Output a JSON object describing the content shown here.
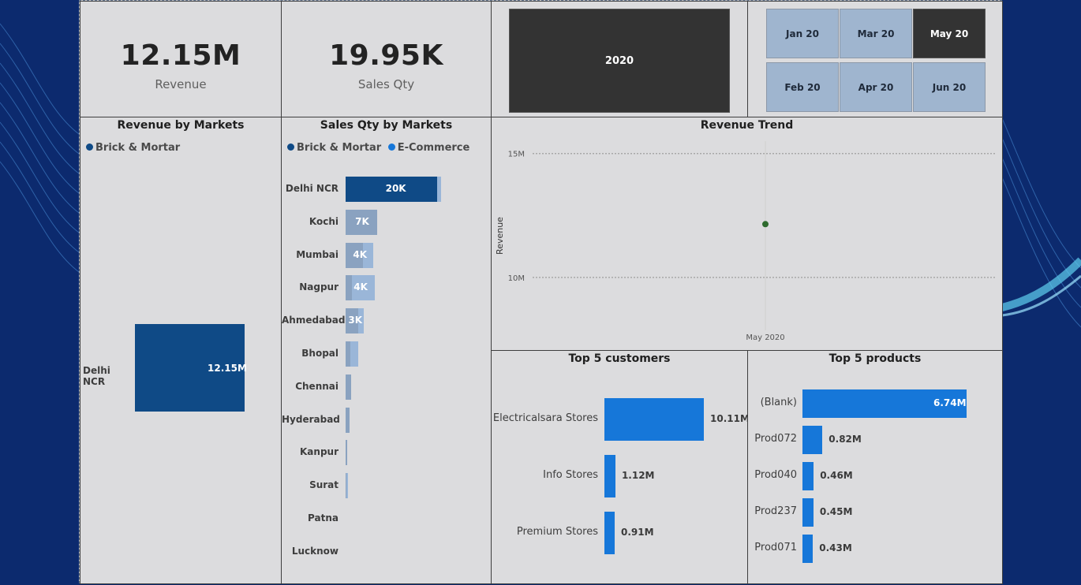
{
  "kpis": [
    {
      "value": "12.15M",
      "label": "Revenue"
    },
    {
      "value": "19.95K",
      "label": "Sales Qty"
    }
  ],
  "year_slicer": {
    "selected": "2020"
  },
  "month_slicer": {
    "items": [
      "Jan 20",
      "Mar 20",
      "May 20",
      "Feb 20",
      "Apr 20",
      "Jun 20"
    ],
    "selected": "May 20"
  },
  "revenue_by_markets": {
    "title": "Revenue by Markets",
    "legend": [
      {
        "name": "Brick & Mortar",
        "color": "#0f4a86"
      }
    ],
    "category": "Delhi NCR",
    "value_label": "12.15M"
  },
  "sales_qty_by_markets": {
    "title": "Sales Qty by Markets",
    "legend": [
      {
        "name": "Brick & Mortar",
        "color": "#0f4a86"
      },
      {
        "name": "E-Commerce",
        "color": "#1677d9"
      }
    ]
  },
  "revenue_trend": {
    "title": "Revenue Trend",
    "ylabel": "Revenue",
    "yticks": [
      "15M",
      "10M"
    ],
    "xtick": "May 2020",
    "point_color": "#2e6b2e"
  },
  "top_customers": {
    "title": "Top 5 customers"
  },
  "top_products": {
    "title": "Top 5 products"
  },
  "chart_data": [
    {
      "type": "bar",
      "title": "Revenue by Markets",
      "categories": [
        "Delhi NCR"
      ],
      "series": [
        {
          "name": "Brick & Mortar",
          "values": [
            12.15
          ]
        }
      ],
      "unit": "M",
      "data_labels": [
        "12.15M"
      ]
    },
    {
      "type": "bar",
      "title": "Sales Qty by Markets",
      "orientation": "horizontal",
      "stacked": true,
      "categories": [
        "Delhi NCR",
        "Kochi",
        "Mumbai",
        "Nagpur",
        "Ahmedabad",
        "Bhopal",
        "Chennai",
        "Hyderabad",
        "Kanpur",
        "Surat",
        "Patna",
        "Lucknow"
      ],
      "series": [
        {
          "name": "Brick & Mortar",
          "values": [
            19.3,
            6.7,
            3.7,
            1.4,
            2.6,
            1.0,
            1.2,
            0.9,
            0.4,
            0.2,
            0,
            0
          ]
        },
        {
          "name": "E-Commerce",
          "values": [
            0.9,
            0,
            2.1,
            4.7,
            1.2,
            1.6,
            0,
            0,
            0,
            0.2,
            0,
            0
          ]
        }
      ],
      "data_labels": [
        "20K",
        "7K",
        "4K",
        "4K",
        "3K",
        "",
        "",
        "",
        "",
        "",
        "",
        ""
      ],
      "xlim": [
        0,
        22
      ]
    },
    {
      "type": "scatter",
      "title": "Revenue Trend",
      "ylabel": "Revenue",
      "x": [
        "May 2020"
      ],
      "y": [
        12.15
      ],
      "ylim": [
        8.5,
        15.5
      ],
      "yticks": [
        "10M",
        "15M"
      ],
      "grid": true
    },
    {
      "type": "bar",
      "title": "Top 5 customers",
      "orientation": "horizontal",
      "categories": [
        "Electricalsara Stores",
        "Info Stores",
        "Premium Stores"
      ],
      "values": [
        10.11,
        1.12,
        0.91
      ],
      "data_labels": [
        "10.11M",
        "1.12M",
        "0.91M"
      ],
      "unit": "M"
    },
    {
      "type": "bar",
      "title": "Top 5 products",
      "orientation": "horizontal",
      "categories": [
        "(Blank)",
        "Prod072",
        "Prod040",
        "Prod237",
        "Prod071"
      ],
      "values": [
        6.74,
        0.82,
        0.46,
        0.45,
        0.43
      ],
      "data_labels": [
        "6.74M",
        "0.82M",
        "0.46M",
        "0.45M",
        "0.43M"
      ],
      "unit": "M"
    }
  ]
}
